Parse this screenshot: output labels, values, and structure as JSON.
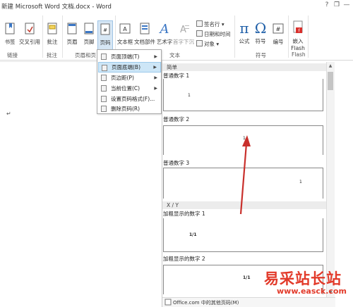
{
  "window": {
    "title": "新建 Microsoft Word 文档.docx - Word",
    "controls": [
      "?",
      "❐",
      "—"
    ]
  },
  "ribbon": {
    "buttons": {
      "bookmark": "书签",
      "crossref": "交叉引用",
      "comment": "批注",
      "header": "页眉",
      "footer": "页脚",
      "pagenum": "页码",
      "textbox": "文本框",
      "quickparts": "文档部件",
      "wordart": "艺术字",
      "dropcap": "首字下沉",
      "signature": "签名行",
      "datetime": "日期和时间",
      "object": "对象",
      "equation": "公式",
      "symbol": "符号",
      "number": "编号",
      "flash_line1": "嵌入",
      "flash_line2": "Flash"
    },
    "groups": {
      "links": "链接",
      "comments": "批注",
      "headerfooter": "页眉和页",
      "text": "文本",
      "symbols": "符号",
      "flash": "Flash"
    }
  },
  "document": {
    "paragraph_mark": "↵"
  },
  "menu": {
    "items": [
      {
        "label": "页面顶端(T)",
        "submenu": true
      },
      {
        "label": "页面底端(B)",
        "submenu": true,
        "highlighted": true
      },
      {
        "label": "页边距(P)",
        "submenu": true
      },
      {
        "label": "当前位置(C)",
        "submenu": true
      },
      {
        "label": "设置页码格式(F)...",
        "submenu": false
      },
      {
        "label": "删除页码(R)",
        "submenu": false
      }
    ]
  },
  "gallery": {
    "sections": {
      "simple": "简单",
      "xy": "X / Y"
    },
    "items": [
      {
        "label": "普通数字 1",
        "sample": "1"
      },
      {
        "label": "普通数字 2",
        "sample": "1"
      },
      {
        "label": "普通数字 3",
        "sample": "1"
      },
      {
        "label": "加粗显示的数字 1",
        "sample": "1/1"
      },
      {
        "label": "加粗显示的数字 2",
        "sample": "1/1"
      }
    ],
    "footer_link": "Office.com 中的其他页码(M)"
  },
  "watermark": {
    "site_name": "易采站长站",
    "url": "www.easck.com"
  },
  "colors": {
    "accent_red": "#e23a2a",
    "highlight": "#cde6f7",
    "pagenum_button": "#d6e6f4"
  }
}
